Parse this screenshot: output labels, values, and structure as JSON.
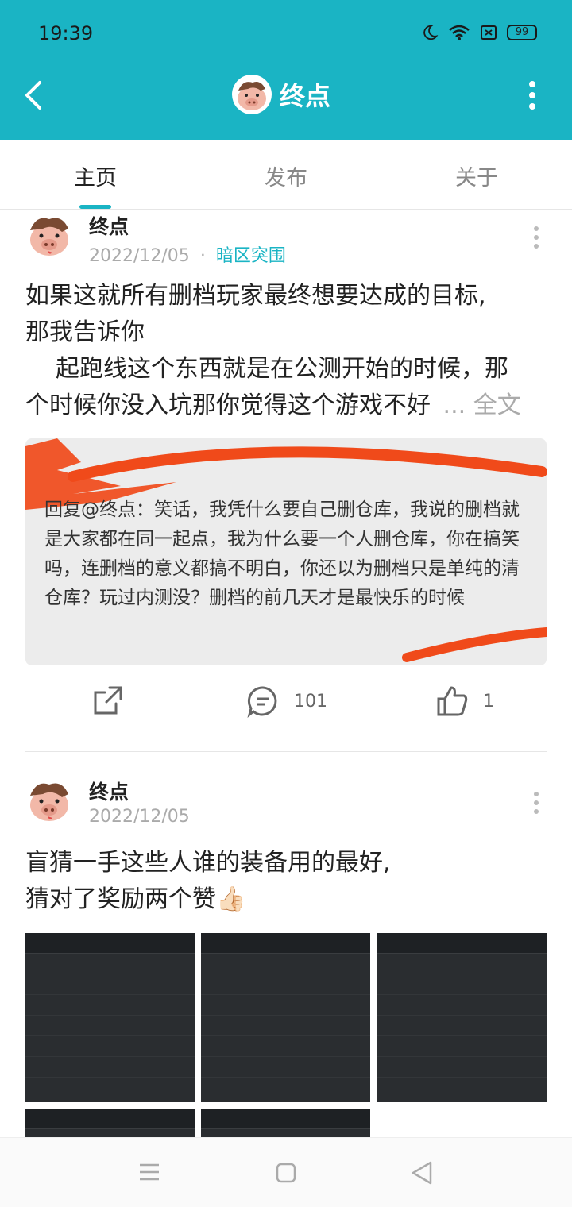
{
  "status_bar": {
    "time": "19:39",
    "battery": "99"
  },
  "header": {
    "title": "终点",
    "avatar_icon": "pig-avatar-icon"
  },
  "tabs": [
    {
      "label": "主页"
    },
    {
      "label": "发布"
    },
    {
      "label": "关于"
    }
  ],
  "posts": [
    {
      "author": "终点",
      "date": "2022/12/05",
      "separator": "·",
      "tag": "暗区突围",
      "text_line1": "如果这就所有删档玩家最终想要达成的目标,",
      "text_line2": "那我告诉你",
      "text_line3": "起跑线这个东西就是在公测开始的时候，那",
      "text_line4": "个时候你没入坑那你觉得这个游戏不好",
      "ellipsis": "...",
      "full_text_link": "全文",
      "image_reply_text": "回复@终点：笑话，我凭什么要自己删仓库，我说的删档就是大家都在同一起点，我为什么要一个人删仓库，你在搞笑吗，连删档的意义都搞不明白，你还以为删档只是单纯的清仓库？玩过内测没？删档的前几天才是最快乐的时候",
      "comment_count": "101",
      "like_count": "1"
    },
    {
      "author": "终点",
      "date": "2022/12/05",
      "text_line1": "盲猜一手这些人谁的装备用的最好,",
      "text_line2": "猜对了奖励两个赞👍🏻"
    }
  ],
  "colors": {
    "accent": "#1ab4c4"
  }
}
